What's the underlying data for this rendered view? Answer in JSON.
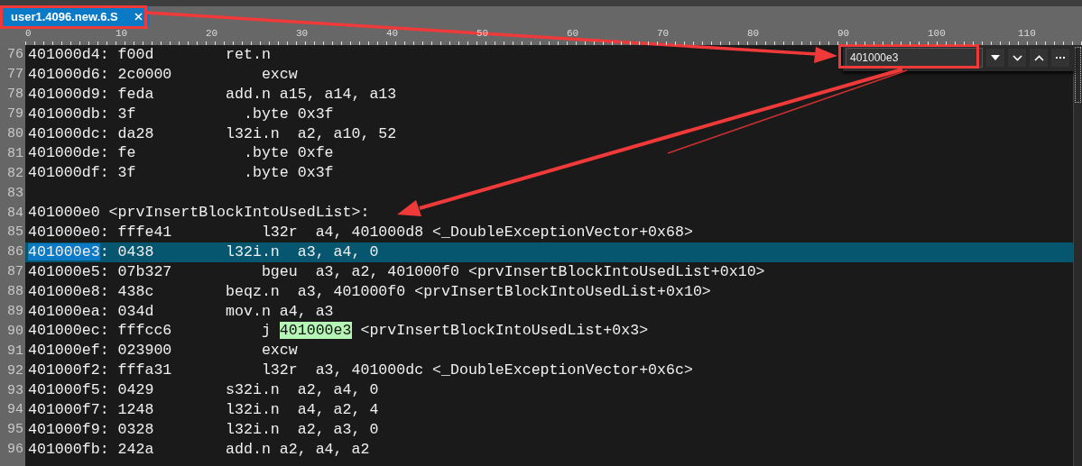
{
  "tabs": [
    {
      "label": "user1.4096.new.6.S",
      "selected": true
    }
  ],
  "ruler": {
    "labels": [
      "0",
      "10",
      "20",
      "30",
      "40",
      "50",
      "60",
      "70",
      "80",
      "90",
      "100",
      "110"
    ]
  },
  "find": {
    "value": "401000e3"
  },
  "lines": [
    {
      "number": "76",
      "current": false,
      "text": "401000d4: f00d        ret.n"
    },
    {
      "number": "77",
      "current": false,
      "text": "401000d6: 2c0000          excw"
    },
    {
      "number": "78",
      "current": false,
      "text": "401000d9: feda        add.n a15, a14, a13"
    },
    {
      "number": "79",
      "current": false,
      "text": "401000db: 3f            .byte 0x3f"
    },
    {
      "number": "80",
      "current": false,
      "text": "401000dc: da28        l32i.n  a2, a10, 52"
    },
    {
      "number": "81",
      "current": false,
      "text": "401000de: fe            .byte 0xfe"
    },
    {
      "number": "82",
      "current": false,
      "text": "401000df: 3f            .byte 0x3f"
    },
    {
      "number": "83",
      "current": false
    },
    {
      "number": "84",
      "current": false,
      "text": "401000e0 <prvInsertBlockIntoUsedList>:"
    },
    {
      "number": "85",
      "current": false,
      "text": "401000e0: fffe41          l32r  a4, 401000d8 <_DoubleExceptionVector+0x68>"
    },
    {
      "number": "86",
      "current": true,
      "parts": [
        {
          "text": "401000e3",
          "kind": "selection"
        },
        {
          "text": ": 0438        l32i.n  a3, a4, 0",
          "kind": "plain"
        }
      ]
    },
    {
      "number": "87",
      "current": false,
      "text": "401000e5: 07b327          bgeu  a3, a2, 401000f0 <prvInsertBlockIntoUsedList+0x10>"
    },
    {
      "number": "88",
      "current": false,
      "text": "401000e8: 438c        beqz.n  a3, 401000f0 <prvInsertBlockIntoUsedList+0x10>"
    },
    {
      "number": "89",
      "current": false,
      "text": "401000ea: 034d        mov.n a4, a3"
    },
    {
      "number": "90",
      "current": false,
      "parts": [
        {
          "text": "401000ec: fffcc6          j ",
          "kind": "plain"
        },
        {
          "text": "401000e3",
          "kind": "match"
        },
        {
          "text": " <prvInsertBlockIntoUsedList+0x3>",
          "kind": "plain"
        }
      ]
    },
    {
      "number": "91",
      "current": false,
      "text": "401000ef: 023900          excw"
    },
    {
      "number": "92",
      "current": false,
      "text": "401000f2: fffa31          l32r  a3, 401000dc <_DoubleExceptionVector+0x6c>"
    },
    {
      "number": "93",
      "current": false,
      "text": "401000f5: 0429        s32i.n  a2, a4, 0"
    },
    {
      "number": "94",
      "current": false,
      "text": "401000f7: 1248        l32i.n  a4, a2, 4"
    },
    {
      "number": "95",
      "current": false,
      "text": "401000f9: 0328        l32i.n  a2, a3, 0"
    },
    {
      "number": "96",
      "current": false,
      "text": "401000fb: 242a        add.n a2, a4, a2"
    }
  ]
}
